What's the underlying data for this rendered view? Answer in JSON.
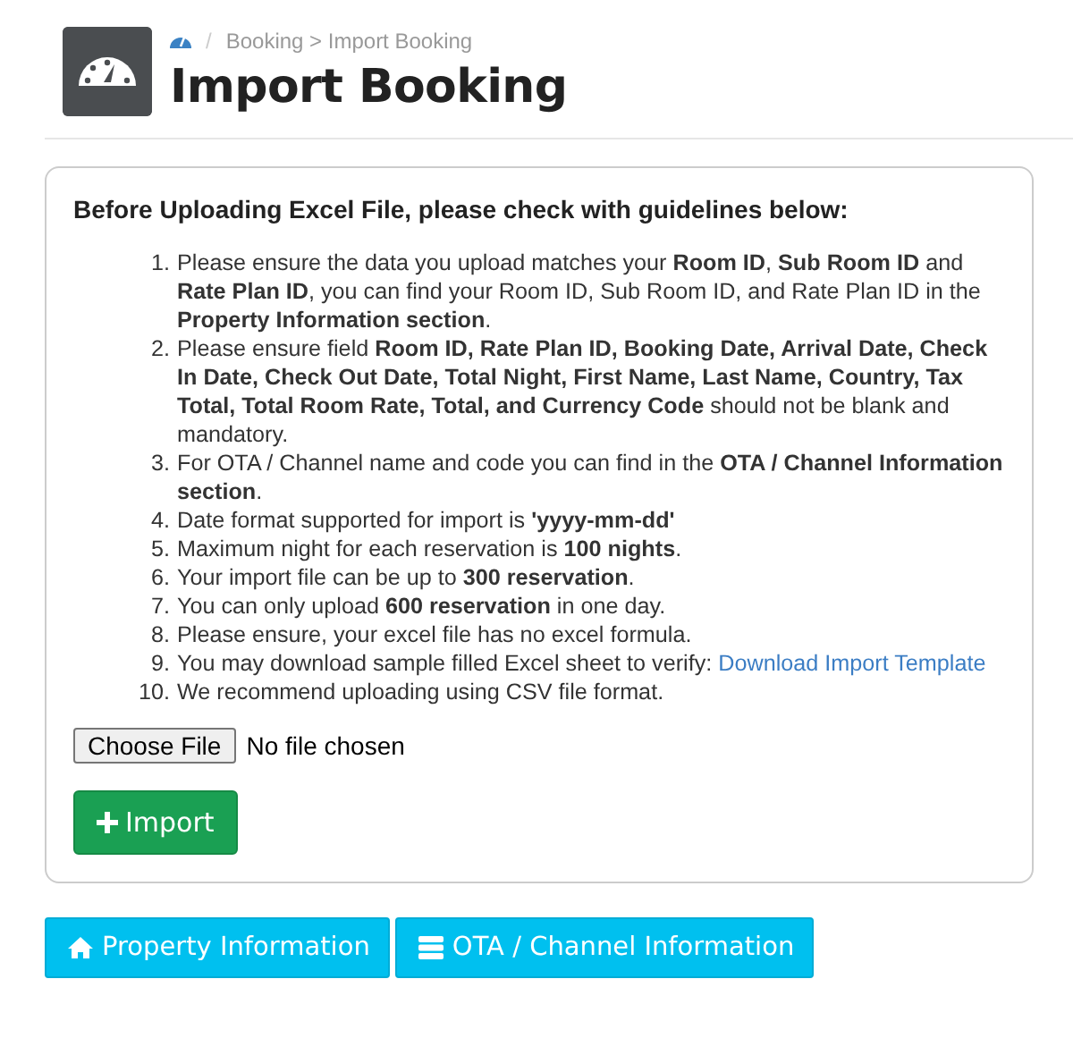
{
  "breadcrumb": {
    "separator": "/",
    "section": "Booking > Import Booking"
  },
  "title": "Import Booking",
  "guidelines": {
    "heading": "Before Uploading Excel File, please check with guidelines below:",
    "items": [
      {
        "number": "1.",
        "text": "Please ensure the data you upload matches your **Room ID**, **Sub Room ID** and **Rate Plan ID**, you can find your Room ID, Sub Room ID, and Rate Plan ID in the **Property Information section**."
      },
      {
        "number": "2.",
        "text": "Please ensure field **Room ID, Rate Plan ID, Booking Date, Arrival Date, Check In Date, Check Out Date, Total Night, First Name, Last Name, Country, Tax Total, Total Room Rate, Total, and Currency Code** should not be blank and mandatory."
      },
      {
        "number": "3.",
        "text": "For OTA / Channel name and code you can find in the **OTA / Channel Information section**."
      },
      {
        "number": "4.",
        "text": "Date format supported for import is **'yyyy-mm-dd'**"
      },
      {
        "number": "5.",
        "text": "Maximum night for each reservation is **100 nights**."
      },
      {
        "number": "6.",
        "text": "Your import file can be up to **300 reservation**."
      },
      {
        "number": "7.",
        "text": "You can only upload **600 reservation** in one day."
      },
      {
        "number": "8.",
        "text": "Please ensure, your excel file has no excel formula."
      },
      {
        "number": "9.",
        "text": "You may download sample filled Excel sheet to verify: ",
        "link": "Download Import Template"
      },
      {
        "number": "10.",
        "text": "We recommend uploading using CSV file format."
      }
    ]
  },
  "file_input": {
    "button": "Choose File",
    "status": "No file chosen"
  },
  "import_button": {
    "label": "Import"
  },
  "nav_buttons": [
    {
      "kind": "home",
      "label": "Property Information"
    },
    {
      "kind": "list",
      "label": "OTA / Channel Information"
    }
  ]
}
